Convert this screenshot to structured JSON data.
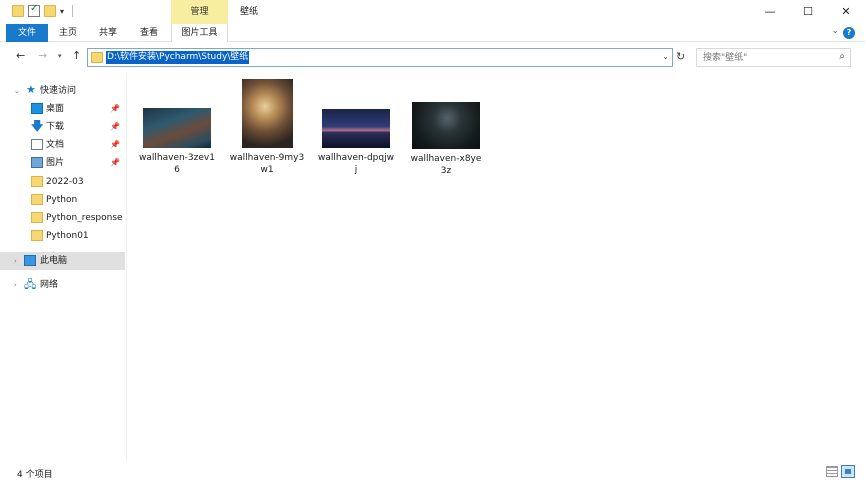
{
  "window": {
    "title": "壁纸",
    "context_tab_group": "管理",
    "controls": {
      "minimize": "—",
      "maximize": "☐",
      "close": "✕"
    }
  },
  "ribbon": {
    "tabs": [
      "文件",
      "主页",
      "共享",
      "查看",
      "图片工具"
    ],
    "collapse": "⌄",
    "help": "?"
  },
  "address": {
    "path": "D:\\软件安装\\Pycharm\\Study\\壁纸",
    "search_placeholder": "搜索\"壁纸\""
  },
  "nav_pane": {
    "quick_access": "快速访问",
    "pinned": [
      {
        "label": "桌面",
        "icon": "desktop-icon"
      },
      {
        "label": "下载",
        "icon": "download-icon"
      },
      {
        "label": "文档",
        "icon": "documents-icon"
      },
      {
        "label": "图片",
        "icon": "pictures-icon"
      }
    ],
    "folders": [
      "2022-03",
      "Python",
      "Python_response",
      "Python01"
    ],
    "this_pc": "此电脑",
    "network": "网络"
  },
  "files": [
    {
      "name": "wallhaven-3zev16"
    },
    {
      "name": "wallhaven-9my3w1"
    },
    {
      "name": "wallhaven-dpqjwj"
    },
    {
      "name": "wallhaven-x8ye3z"
    }
  ],
  "status": {
    "item_count": "4 个项目"
  },
  "colors": {
    "accent": "#1979ca",
    "manage_tab": "#f8eea0",
    "selection": "#0a64c8",
    "folder": "#f7d774"
  }
}
